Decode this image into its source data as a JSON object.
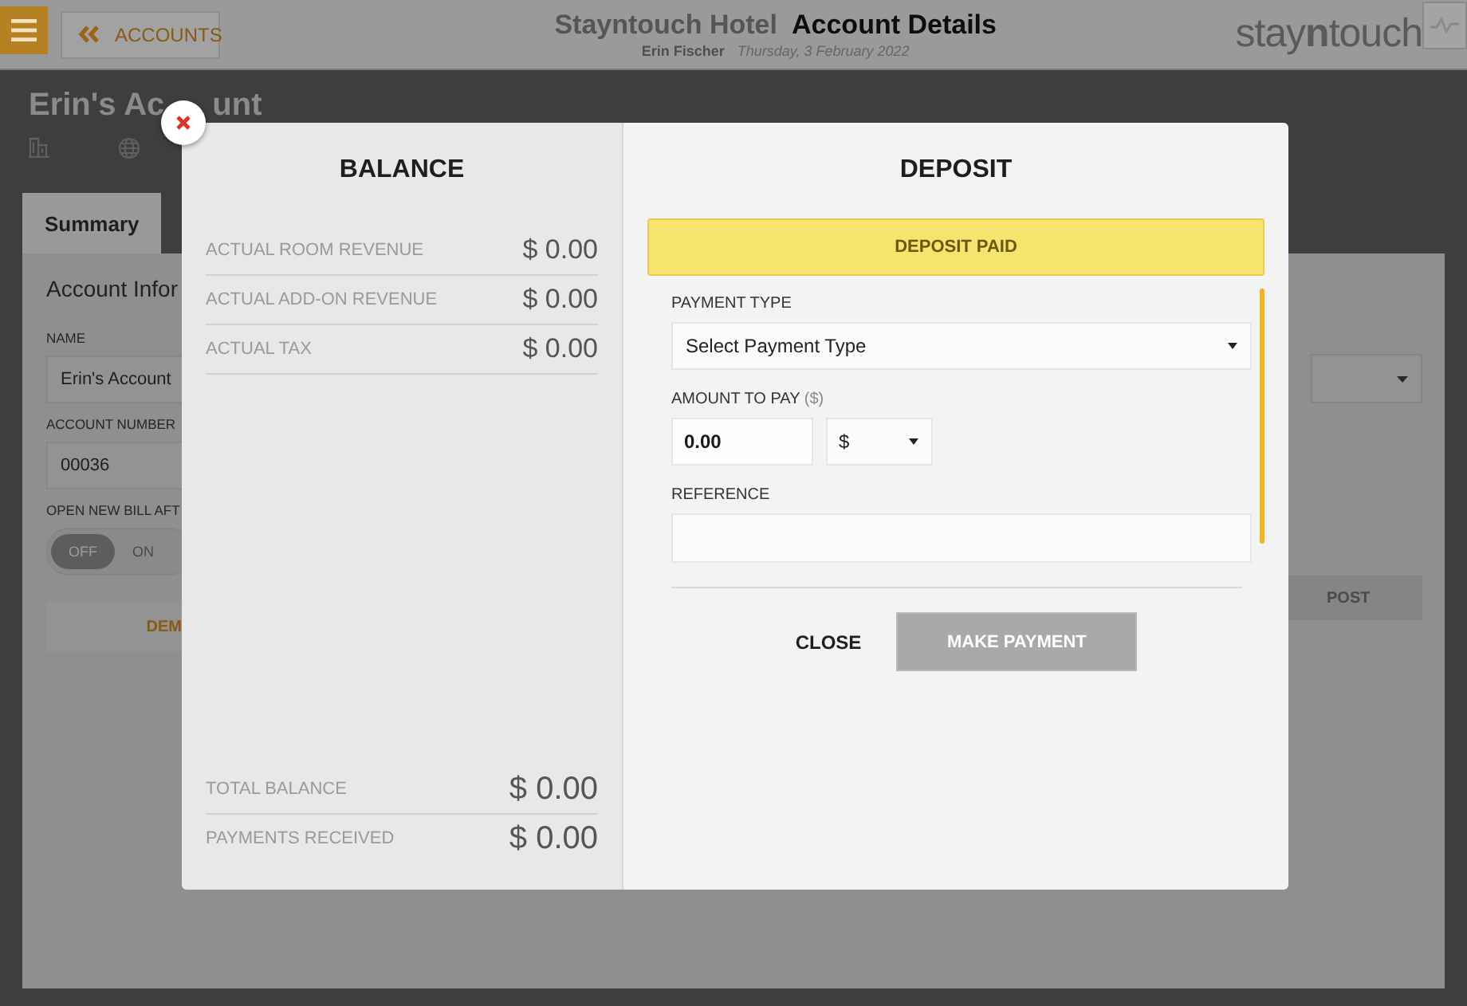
{
  "header": {
    "back_button": {
      "label": "ACCOUNTS"
    },
    "hotel_name": "Stayntouch Hotel",
    "page_title": "Account Details",
    "user_name": "Erin Fischer",
    "date": "Thursday, 3 February 2022",
    "logo": "stay**n**touch"
  },
  "account": {
    "title_parts": [
      "Erin's Ac",
      "unt"
    ],
    "tabs": [
      {
        "label": "Summary",
        "selected": true
      }
    ],
    "section_title": "Account Infor",
    "fields": [
      {
        "label": "NAME",
        "value": "Erin's Account"
      },
      {
        "label": "ACCOUNT NUMBER",
        "value": "00036"
      }
    ],
    "toggle": {
      "label": "OPEN NEW BILL AFT",
      "options": [
        {
          "label": "OFF",
          "selected": true
        },
        {
          "label": "ON",
          "selected": false
        }
      ]
    },
    "demo_button": "DEM",
    "post_button": "POST"
  },
  "modal": {
    "balance": {
      "title": "BALANCE",
      "rows": [
        {
          "label": "ACTUAL ROOM REVENUE",
          "value": "$ 0.00"
        },
        {
          "label": "ACTUAL ADD-ON REVENUE",
          "value": "$ 0.00"
        },
        {
          "label": "ACTUAL TAX",
          "value": "$ 0.00"
        }
      ],
      "totals": [
        {
          "label": "TOTAL BALANCE",
          "value": "$ 0.00"
        },
        {
          "label": "PAYMENTS RECEIVED",
          "value": "$ 0.00"
        }
      ]
    },
    "deposit": {
      "title": "DEPOSIT",
      "status": "DEPOSIT PAID",
      "payment_type": {
        "label": "PAYMENT TYPE",
        "value": "Select Payment Type"
      },
      "amount": {
        "label": "AMOUNT TO PAY",
        "label_unit": "($)",
        "value": "0.00",
        "currency": "$"
      },
      "reference": {
        "label": "REFERENCE"
      },
      "close_button": "CLOSE",
      "make_payment": {
        "label": "MAKE PAYMENT",
        "disabled": true
      }
    }
  }
}
